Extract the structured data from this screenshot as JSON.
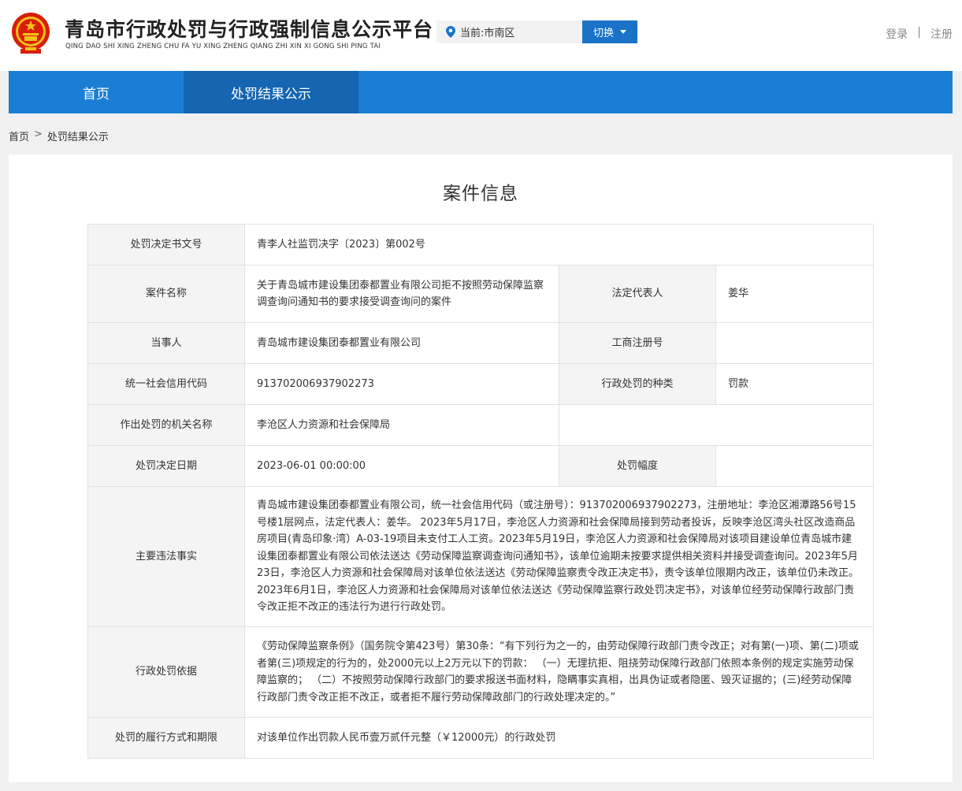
{
  "header": {
    "site_title": "青岛市行政处罚与行政强制信息公示平台",
    "site_pinyin": "QING DAO SHI XING ZHENG CHU FA YU XING ZHENG QIANG ZHI XIN XI GONG SHI PING TAI",
    "location_text": "当前:市南区",
    "switch_label": "切换",
    "login_label": "登录",
    "divider": "|",
    "register_label": "注册"
  },
  "nav": {
    "items": [
      {
        "label": "首页"
      },
      {
        "label": "处罚结果公示"
      }
    ]
  },
  "breadcrumb": {
    "home": "首页",
    "sep": ">",
    "current": "处罚结果公示"
  },
  "panel": {
    "title": "案件信息"
  },
  "case": {
    "doc_no_label": "处罚决定书文号",
    "doc_no": "青李人社监罚决字〔2023〕第002号",
    "case_name_label": "案件名称",
    "case_name": "关于青岛城市建设集团泰都置业有限公司拒不按照劳动保障监察调查询问通知书的要求接受调查询问的案件",
    "legal_rep_label": "法定代表人",
    "legal_rep": "姜华",
    "party_label": "当事人",
    "party": "青岛城市建设集团泰都置业有限公司",
    "biz_reg_label": "工商注册号",
    "biz_reg": "",
    "credit_code_label": "统一社会信用代码",
    "credit_code": "913702006937902273",
    "penalty_type_label": "行政处罚的种类",
    "penalty_type": "罚款",
    "authority_label": "作出处罚的机关名称",
    "authority": "李沧区人力资源和社会保障局",
    "decision_date_label": "处罚决定日期",
    "decision_date": "2023-06-01 00:00:00",
    "penalty_range_label": "处罚幅度",
    "penalty_range": "",
    "facts_label": "主要违法事实",
    "facts": "青岛城市建设集团泰都置业有限公司，统一社会信用代码（或注册号）：913702006937902273，注册地址：李沧区湘潭路56号15号楼1层网点，法定代表人：姜华。 2023年5月17日，李沧区人力资源和社会保障局接到劳动者投诉，反映李沧区湾头社区改造商品房项目(青岛印象·湾）A-03-19项目未支付工人工资。2023年5月19日，李沧区人力资源和社会保障局对该项目建设单位青岛城市建设集团泰都置业有限公司依法送达《劳动保障监察调查询问通知书》，该单位逾期未按要求提供相关资料并接受调查询问。2023年5月23日，李沧区人力资源和社会保障局对该单位依法送达《劳动保障监察责令改正决定书》，责令该单位限期内改正，该单位仍未改正。2023年6月1日，李沧区人力资源和社会保障局对该单位依法送达《劳动保障监察行政处罚决定书》，对该单位经劳动保障行政部门责令改正拒不改正的违法行为进行行政处罚。",
    "basis_label": "行政处罚依据",
    "basis": "《劳动保障监察条例》（国务院令第423号）第30条：“有下列行为之一的，由劳动保障行政部门责令改正；对有第(一)项、第(二)项或者第(三)项规定的行为的，处2000元以上2万元以下的罚款： （一）无理抗拒、阻挠劳动保障行政部门依照本条例的规定实施劳动保障监察的； （二）不按照劳动保障行政部门的要求报送书面材料，隐瞒事实真相，出具伪证或者隐匿、毁灭证据的；(三)经劳动保障行政部门责令改正拒不改正，或者拒不履行劳动保障政部门的行政处理决定的。”",
    "execution_label": "处罚的履行方式和期限",
    "execution": "对该单位作出罚款人民币壹万贰仟元整（￥12000元）的行政处罚"
  },
  "colors": {
    "nav_bg": "#1a7fd4",
    "nav_active": "#1565b0",
    "switch_bg": "#1a73c8",
    "emblem_red": "#d81e06",
    "emblem_gold": "#f5c21b"
  }
}
